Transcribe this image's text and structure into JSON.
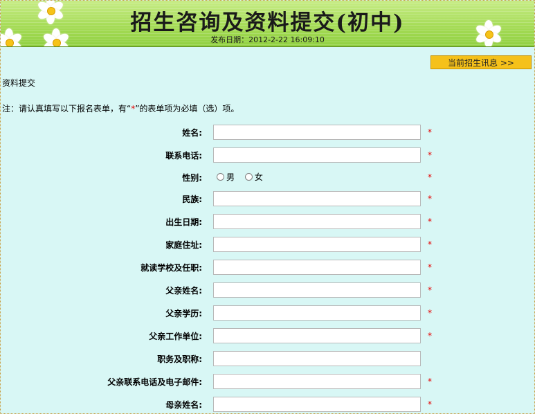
{
  "banner": {
    "title": "招生咨询及资料提交(初中)",
    "date_label": "发布日期：",
    "date_value": "2012-2-22 16:09:10"
  },
  "news_button": {
    "label": "当前招生讯息 >>"
  },
  "section_label": "资料提交",
  "note": {
    "prefix": "注：请认真填写以下报名表单，有“",
    "star": "*",
    "suffix": "”的表单项为必填（选）项。"
  },
  "form": {
    "required_mark": "*",
    "fields": [
      {
        "label": "姓名:",
        "type": "text",
        "value": "",
        "required": true
      },
      {
        "label": "联系电话:",
        "type": "text",
        "value": "",
        "required": true
      },
      {
        "label": "性别:",
        "type": "radio",
        "options": [
          "男",
          "女"
        ],
        "selected": "",
        "required": true
      },
      {
        "label": "民族:",
        "type": "text",
        "value": "",
        "required": true
      },
      {
        "label": "出生日期:",
        "type": "text",
        "value": "",
        "required": true
      },
      {
        "label": "家庭住址:",
        "type": "text",
        "value": "",
        "required": true
      },
      {
        "label": "就读学校及任职:",
        "type": "text",
        "value": "",
        "required": true
      },
      {
        "label": "父亲姓名:",
        "type": "text",
        "value": "",
        "required": true
      },
      {
        "label": "父亲学历:",
        "type": "text",
        "value": "",
        "required": true
      },
      {
        "label": "父亲工作单位:",
        "type": "text",
        "value": "",
        "required": true
      },
      {
        "label": "职务及职称:",
        "type": "text",
        "value": "",
        "required": false
      },
      {
        "label": "父亲联系电话及电子邮件:",
        "type": "text",
        "value": "",
        "required": true
      },
      {
        "label": "母亲姓名:",
        "type": "text",
        "value": "",
        "required": true
      }
    ]
  },
  "colors": {
    "page_background": "#d8f7f5",
    "banner_green": "#a6dc57",
    "button_yellow": "#f5c11a",
    "required_red": "#e60000"
  },
  "icons": [
    "daffodil-flower-icon"
  ]
}
